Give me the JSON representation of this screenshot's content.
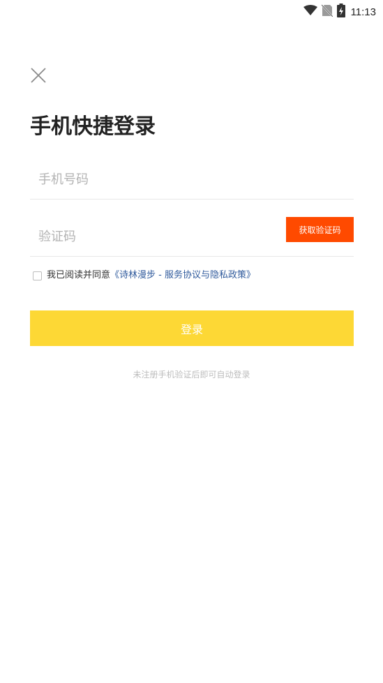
{
  "status_bar": {
    "time": "11:13",
    "icons": [
      "wifi-icon",
      "no-sim-icon",
      "battery-charging-icon"
    ]
  },
  "login": {
    "close_icon": "close-icon",
    "title": "手机快捷登录",
    "phone": {
      "placeholder": "手机号码",
      "value": ""
    },
    "code": {
      "placeholder": "验证码",
      "value": ""
    },
    "get_code_label": "获取验证码",
    "agreement": {
      "checked": false,
      "prefix": "我已阅读并同意",
      "link": "《诗林漫步 - 服务协议与隐私政策》"
    },
    "login_label": "登录",
    "hint": "未注册手机验证后即可自动登录"
  },
  "colors": {
    "accent_orange": "#ff4a00",
    "login_yellow": "#fdd835",
    "link_blue": "#2f5a9c",
    "placeholder_gray": "#b3b3b3"
  }
}
